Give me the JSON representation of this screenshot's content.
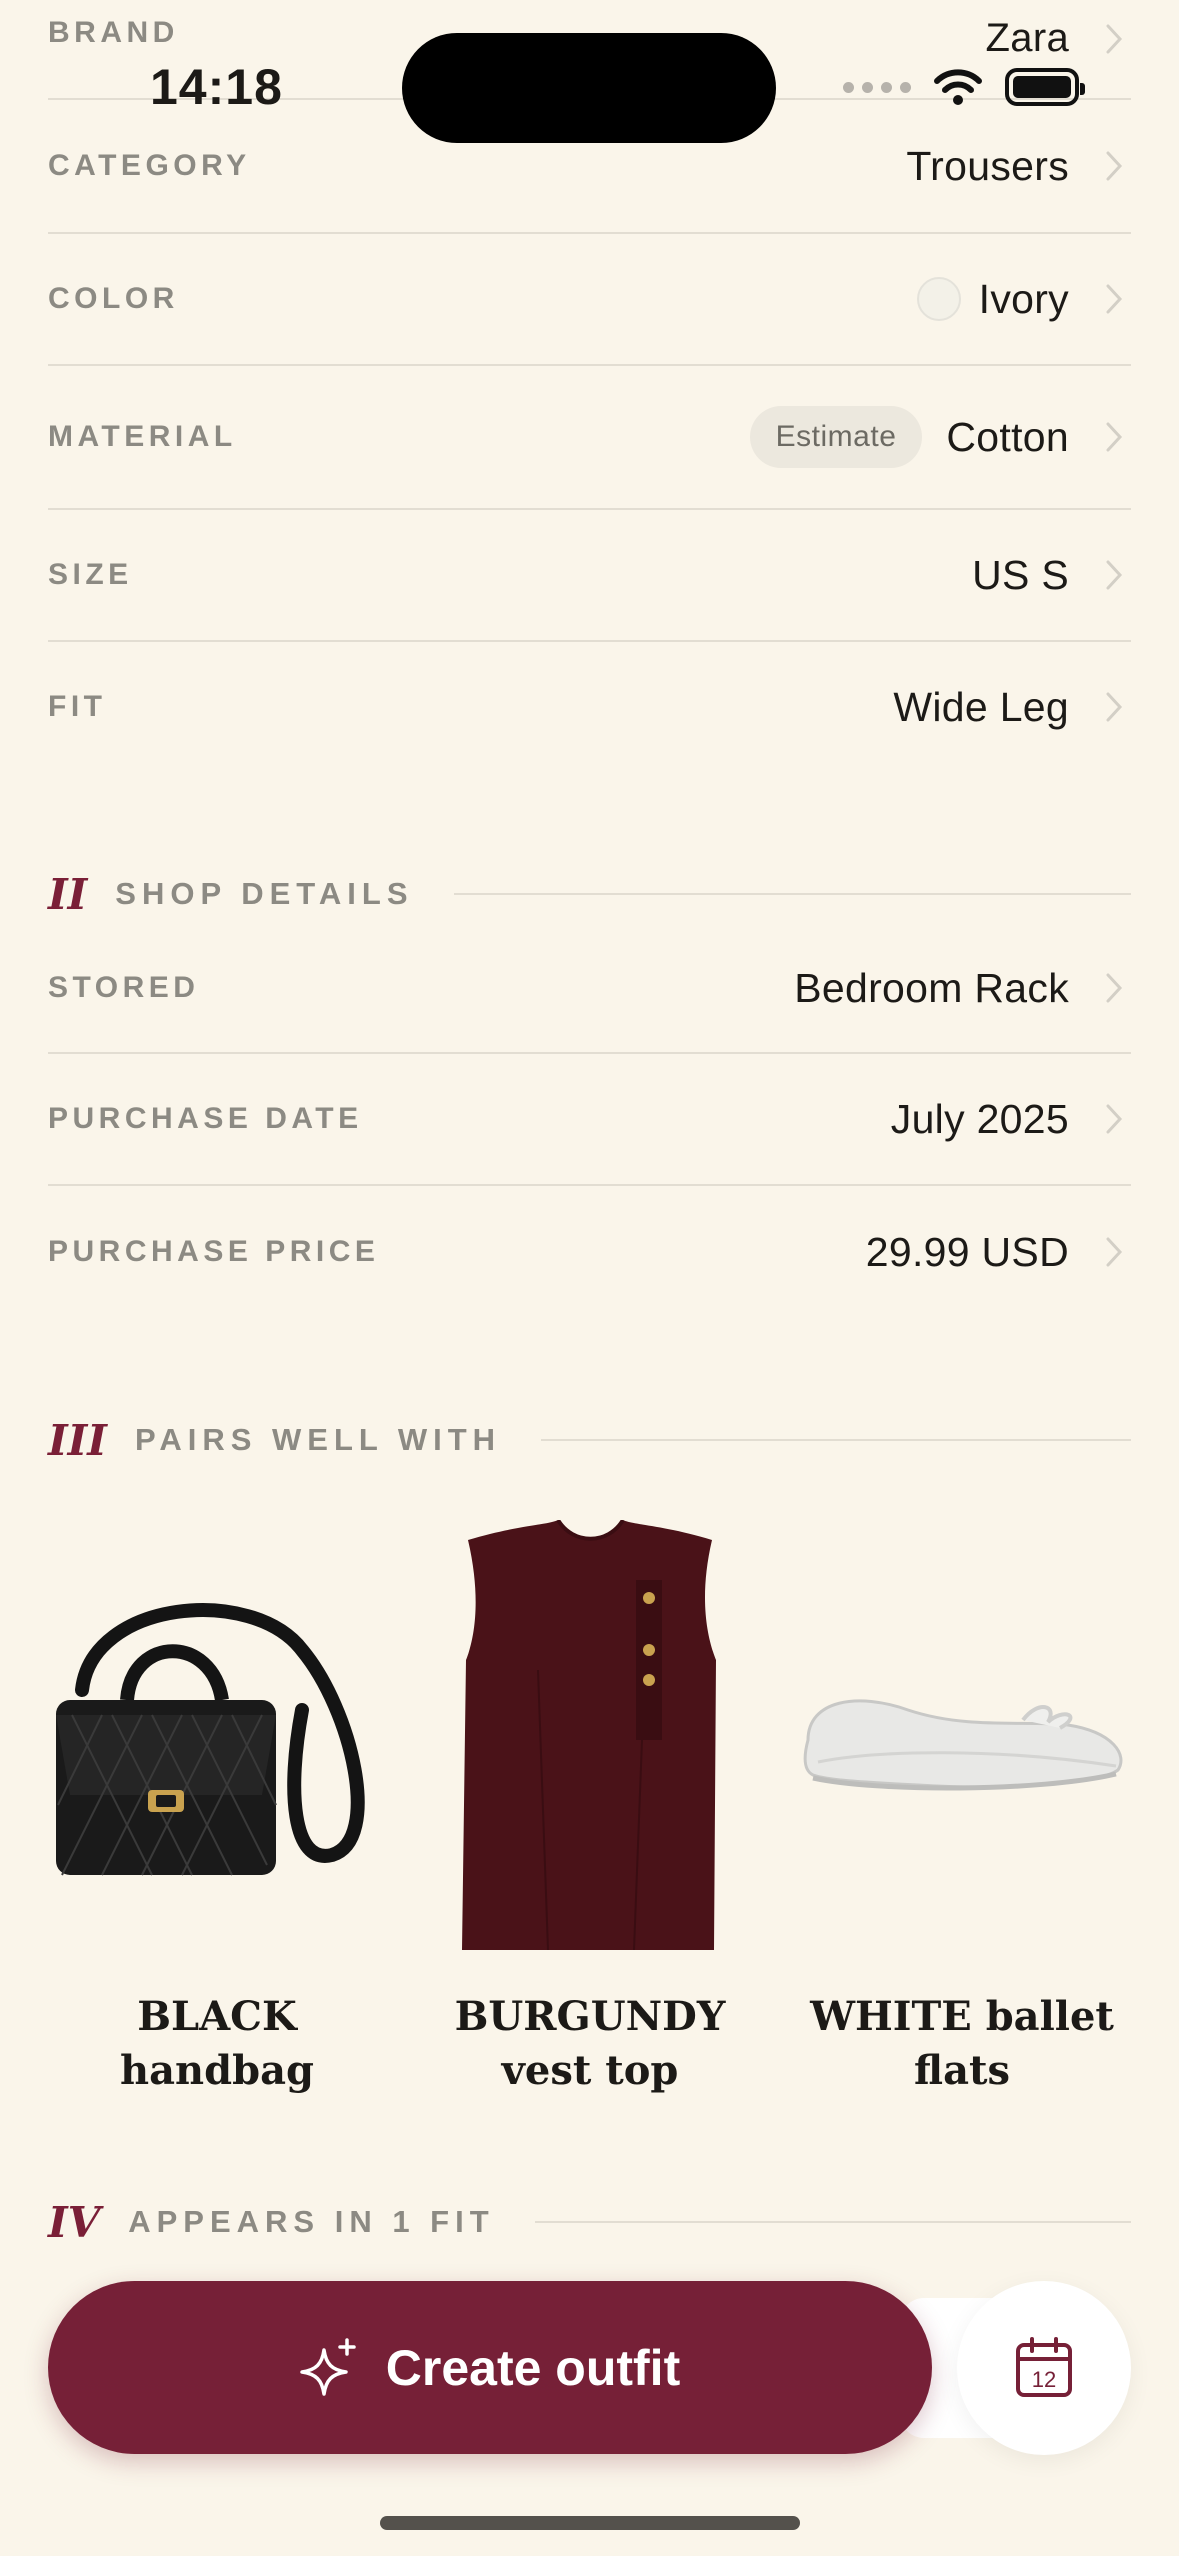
{
  "status_bar": {
    "time": "14:18"
  },
  "attributes": [
    {
      "key": "brand",
      "label": "BRAND",
      "value": "Zara"
    },
    {
      "key": "category",
      "label": "CATEGORY",
      "value": "Trousers"
    },
    {
      "key": "color",
      "label": "COLOR",
      "value": "Ivory",
      "swatch": "#f3f1e8"
    },
    {
      "key": "material",
      "label": "MATERIAL",
      "value": "Cotton",
      "badge": "Estimate"
    },
    {
      "key": "size",
      "label": "SIZE",
      "value": "US S"
    },
    {
      "key": "fit",
      "label": "FIT",
      "value": "Wide Leg"
    }
  ],
  "sections": [
    {
      "numeral": "II",
      "title": "SHOP DETAILS"
    },
    {
      "numeral": "III",
      "title": "PAIRS WELL WITH"
    },
    {
      "numeral": "IV",
      "title": "APPEARS IN 1 FIT"
    }
  ],
  "shop_details": [
    {
      "key": "stored",
      "label": "STORED",
      "value": "Bedroom Rack"
    },
    {
      "key": "purchase_date",
      "label": "PURCHASE DATE",
      "value": "July 2025"
    },
    {
      "key": "purchase_price",
      "label": "PURCHASE PRICE",
      "value": "29.99 USD"
    }
  ],
  "pairs": [
    {
      "line1": "BLACK",
      "line2": "handbag"
    },
    {
      "line1": "BURGUNDY",
      "line2": "vest top"
    },
    {
      "line1": "WHITE ballet",
      "line2": "flats"
    }
  ],
  "actions": {
    "create_outfit": "Create outfit",
    "calendar_day": "12"
  },
  "colors": {
    "accent": "#762037",
    "background": "#faf5ea",
    "label": "#8c8a83"
  }
}
